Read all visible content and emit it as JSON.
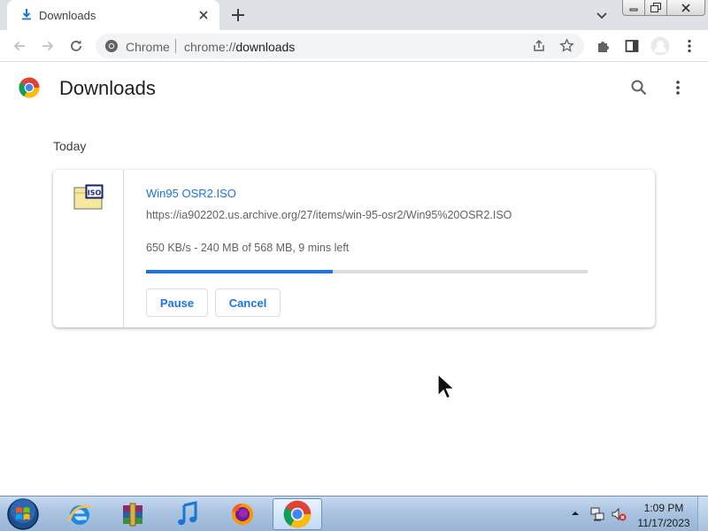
{
  "browser": {
    "tab": {
      "title": "Downloads"
    },
    "omnibox": {
      "site_name": "Chrome",
      "url_scheme": "chrome://",
      "url_path": "downloads"
    }
  },
  "page": {
    "title": "Downloads",
    "date_heading": "Today"
  },
  "download": {
    "file_name": "Win95 OSR2.ISO",
    "url": "https://ia902202.us.archive.org/27/items/win-95-osr2/Win95%20OSR2.ISO",
    "status": "650 KB/s - 240 MB of 568 MB, 9 mins left",
    "progress_fraction": 0.4225,
    "file_icon_label": "ISO",
    "buttons": {
      "pause": "Pause",
      "cancel": "Cancel"
    }
  },
  "taskbar": {
    "apps": [
      "internet-explorer",
      "winrar",
      "itunes",
      "firefox",
      "chrome"
    ],
    "active_app": "chrome",
    "clock": {
      "time": "1:09 PM",
      "date": "11/17/2023"
    }
  },
  "colors": {
    "accent": "#1a73e8",
    "tabstrip": "#dee1e6",
    "omnibox": "#f1f3f4"
  }
}
